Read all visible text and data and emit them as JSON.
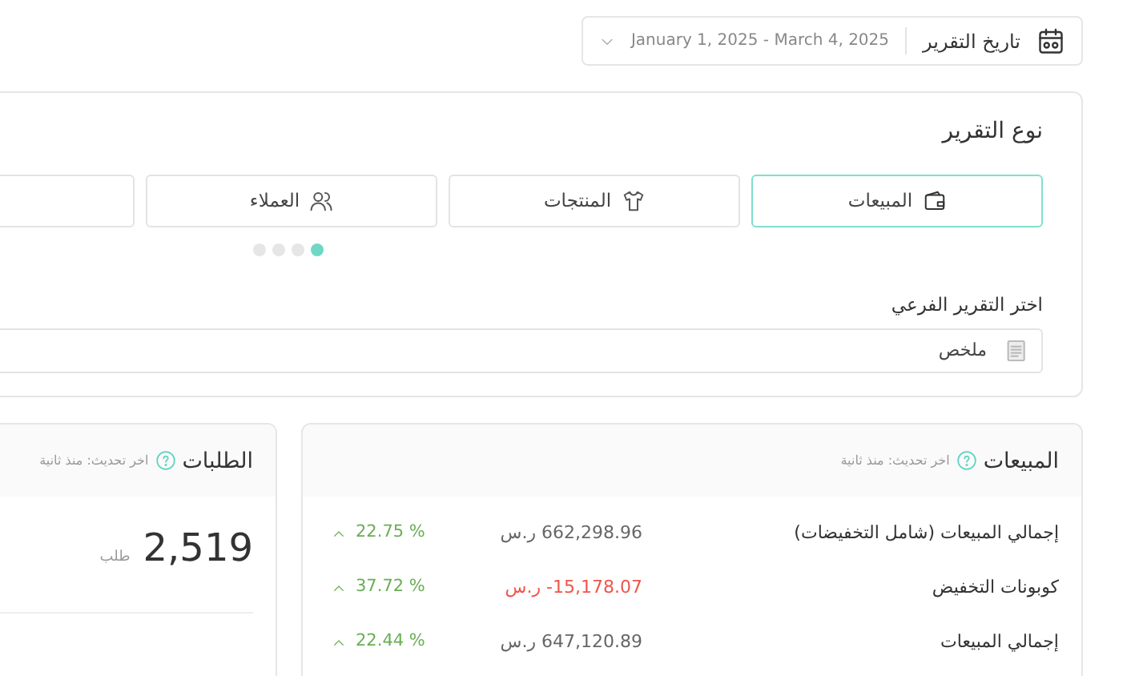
{
  "date_filter": {
    "label": "تاريخ التقرير",
    "value": "January 1, 2025 - March 4, 2025"
  },
  "report_type": {
    "title": "نوع التقرير",
    "tabs": [
      {
        "label": "المبيعات",
        "selected": true
      },
      {
        "label": "المنتجات",
        "selected": false
      },
      {
        "label": "العملاء",
        "selected": false
      },
      {
        "selected": false
      }
    ],
    "pager_dots": [
      {
        "selected": true
      },
      {
        "selected": false
      },
      {
        "selected": false
      },
      {
        "selected": false
      }
    ],
    "subreport": {
      "label": "اختر التقرير الفرعي",
      "value": "ملخص"
    }
  },
  "sales_card": {
    "title": "المبيعات",
    "updated": "اخر تحديث: منذ ثانية",
    "rows": [
      {
        "label": "إجمالي المبيعات (شامل التخفيضات)",
        "value": "662,298.96 ر.س",
        "negative": false,
        "change": "22.75 %"
      },
      {
        "label": "كوبونات التخفيض",
        "value": "-15,178.07 ر.س",
        "negative": true,
        "change": "37.72 %"
      },
      {
        "label": "إجمالي المبيعات",
        "value": "647,120.89 ر.س",
        "negative": false,
        "change": "22.44 %"
      }
    ]
  },
  "orders_card": {
    "title": "الطلبات",
    "updated": "اخر تحديث: منذ ثانية",
    "count": "2,519",
    "unit": "طلب"
  }
}
